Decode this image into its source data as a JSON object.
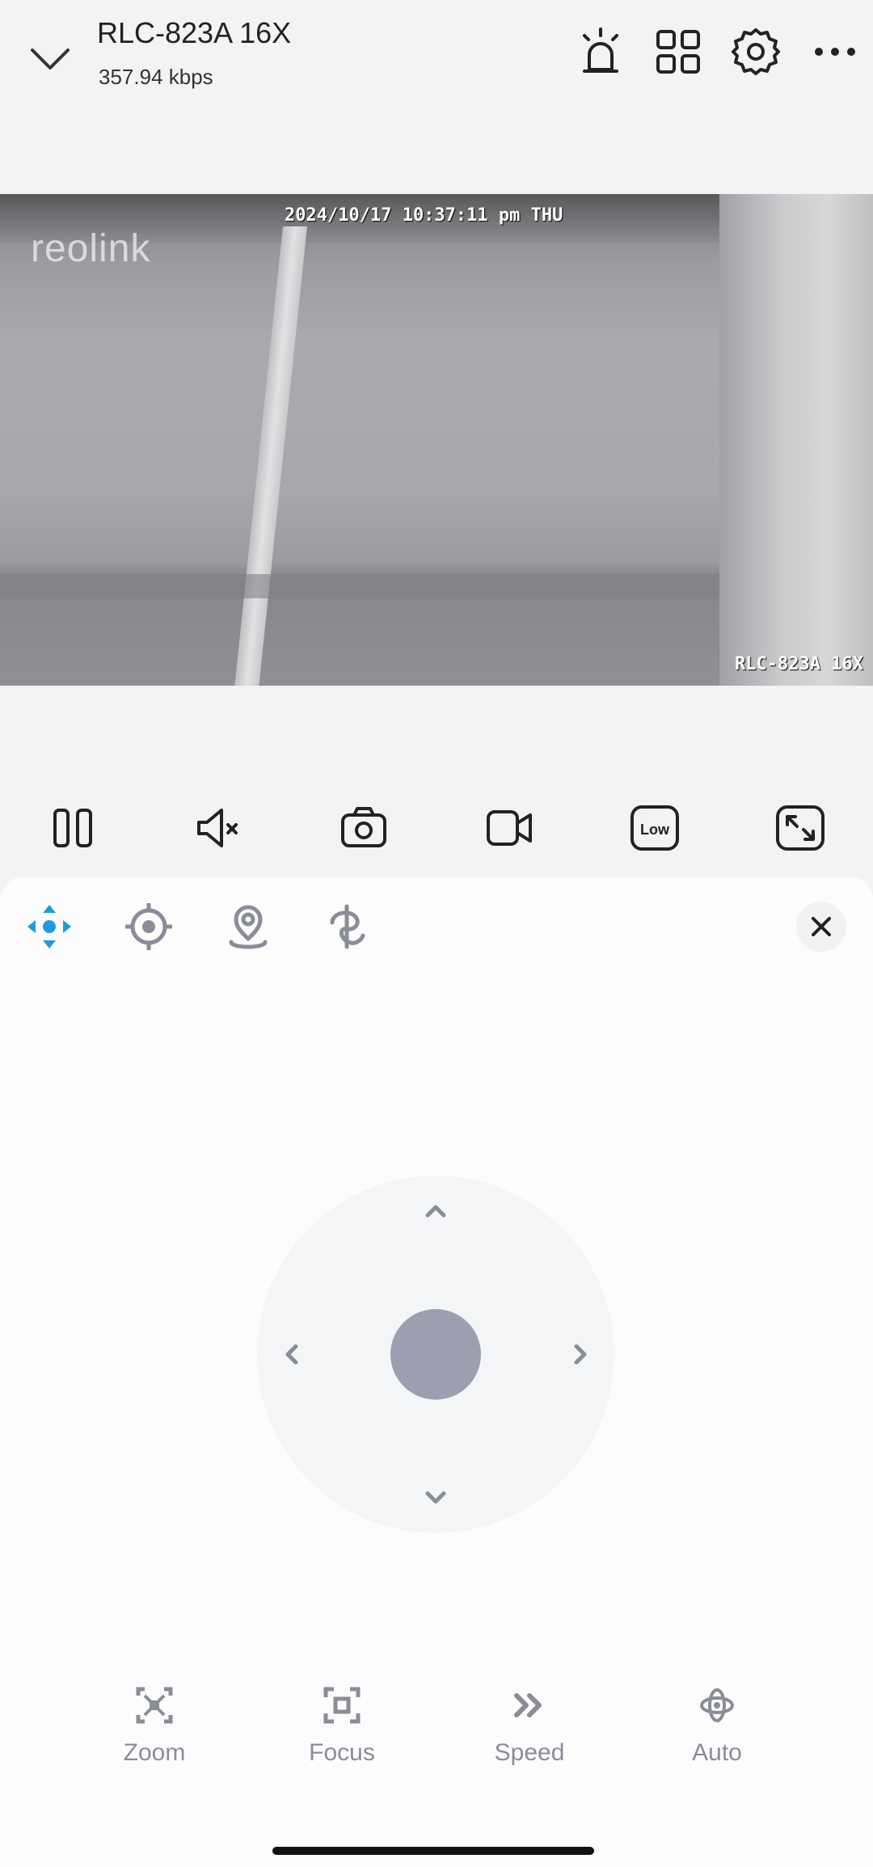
{
  "header": {
    "title": "RLC-823A 16X",
    "bitrate": "357.94 kbps",
    "icons": [
      "chevron-down-icon",
      "siren-icon",
      "grid-icon",
      "gear-icon",
      "more-icon"
    ]
  },
  "video": {
    "timestamp": "2024/10/17 10:37:11 pm THU",
    "camera_label": "RLC-823A 16X",
    "logo_text": "reolink"
  },
  "toolbar": {
    "icons": [
      "pause-icon",
      "mute-icon",
      "snapshot-icon",
      "record-icon",
      "quality-low-icon",
      "fullscreen-icon"
    ],
    "quality_label": "Low"
  },
  "ptz": {
    "modes": [
      "ptz-direction-icon",
      "preset-target-icon",
      "location-pin-icon",
      "patrol-icon"
    ],
    "active_mode": "ptz-direction-icon",
    "bottom_controls": [
      {
        "label": "Zoom",
        "icon": "zoom-icon"
      },
      {
        "label": "Focus",
        "icon": "focus-icon"
      },
      {
        "label": "Speed",
        "icon": "speed-icon"
      },
      {
        "label": "Auto",
        "icon": "auto-icon"
      }
    ]
  },
  "colors": {
    "accent": "#1e9be0",
    "icon_gray": "#8a8d98",
    "knob": "#9c9fb0",
    "background": "#f2f3f5"
  }
}
